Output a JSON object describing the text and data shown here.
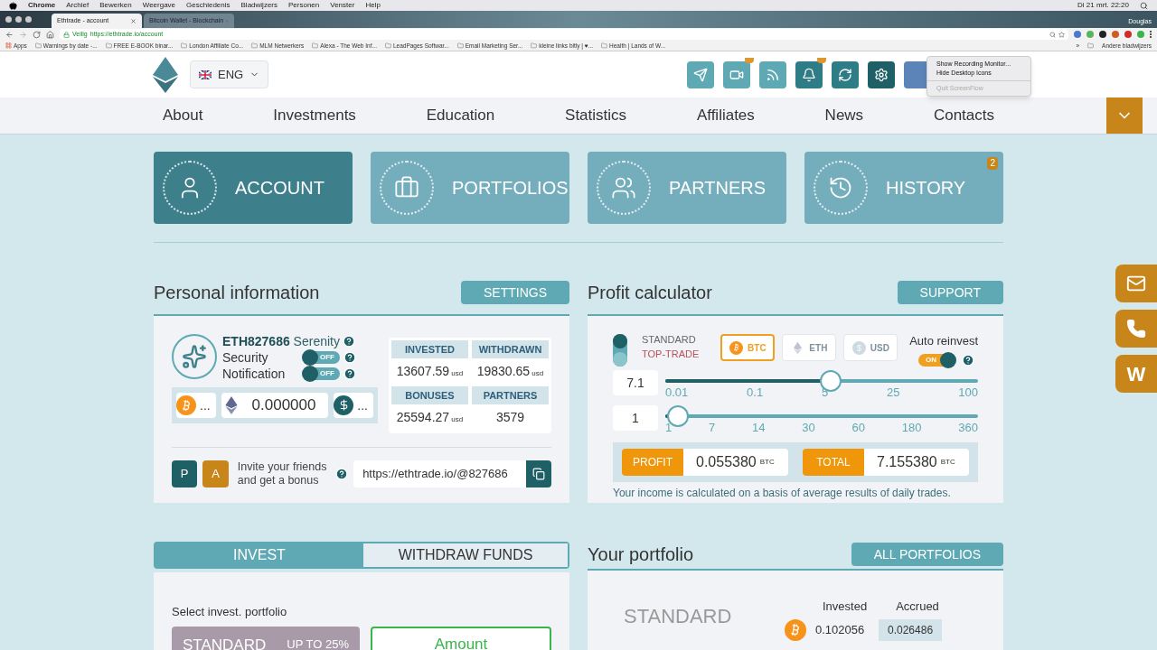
{
  "menubar": {
    "items": [
      "Chrome",
      "Archief",
      "Bewerken",
      "Weergave",
      "Geschiedenis",
      "Bladwijzers",
      "Personen",
      "Venster",
      "Help"
    ],
    "clock": "Di 21 mrt. 22:20"
  },
  "browser": {
    "tabs": [
      {
        "title": "Ethtrade - account",
        "selected": true
      },
      {
        "title": "Bitcoin Wallet - Blockchain",
        "selected": false
      }
    ],
    "user": "Douglas",
    "secure_label": "Veilig",
    "url": "https://ethtrade.io/account",
    "bookmarks": [
      "Apps",
      "Warnings by date -...",
      "FREE E-BOOK binar...",
      "London Affiliate Co...",
      "MLM Netwerkers",
      "Alexa - The Web Inf...",
      "LeadPages Softwar...",
      "Email Marketing Ser...",
      "kleine links bitly | ♥...",
      "Health | Lands of W..."
    ],
    "more": "»",
    "other_bookmarks": "Andere bladwijzers"
  },
  "header": {
    "language": "ENG",
    "toolbar": [
      {
        "kind": "send",
        "badge": false
      },
      {
        "kind": "video",
        "badge": true
      },
      {
        "kind": "rss",
        "badge": false
      },
      {
        "kind": "bell",
        "badge": true
      },
      {
        "kind": "exchange",
        "badge": false
      },
      {
        "kind": "settings",
        "badge": false
      },
      {
        "kind": "blank",
        "badge": false
      }
    ],
    "context_menu": [
      {
        "label": "Show Recording Monitor...",
        "disabled": false
      },
      {
        "label": "Hide Desktop Icons",
        "disabled": false
      },
      {
        "label": "Quit ScreenFlow",
        "disabled": true
      }
    ]
  },
  "nav": [
    "About",
    "Investments",
    "Education",
    "Statistics",
    "Affiliates",
    "News",
    "Contacts"
  ],
  "cards": [
    {
      "kind": "account",
      "label": "ACCOUNT",
      "selected": true
    },
    {
      "kind": "portfolios",
      "label": "PORTFOLIOS",
      "selected": false
    },
    {
      "kind": "partners",
      "label": "PARTNERS",
      "selected": false
    },
    {
      "kind": "history",
      "label": "HISTORY",
      "selected": false,
      "badge": "2"
    }
  ],
  "personal": {
    "title": "Personal information",
    "button": "SETTINGS",
    "user_id": "ETH827686",
    "user_name": "Serenity",
    "toggles": [
      {
        "label": "Security",
        "on": false,
        "text": "OFF"
      },
      {
        "label": "Notification",
        "on": false,
        "text": "OFF"
      }
    ],
    "balances": [
      {
        "kind": "btc",
        "value": "..."
      },
      {
        "kind": "eth",
        "value": "0.000000"
      },
      {
        "kind": "usd",
        "value": "..."
      }
    ],
    "stats": [
      {
        "label": "INVESTED",
        "value": "13607.59",
        "unit": "usd"
      },
      {
        "label": "WITHDRAWN",
        "value": "19830.65",
        "unit": "usd"
      },
      {
        "label": "BONUSES",
        "value": "25594.27",
        "unit": "usd"
      },
      {
        "label": "PARTNERS",
        "value": "3579"
      }
    ],
    "badges": [
      {
        "label": "P",
        "color": "#1f5f66"
      },
      {
        "label": "A",
        "color": "#c8861a"
      }
    ],
    "invite": "Invite your friends and get a bonus",
    "link": "https://ethtrade.io/@827686"
  },
  "calculator": {
    "title": "Profit calculator",
    "button": "SUPPORT",
    "plans": [
      {
        "label": "STANDARD",
        "selected": true,
        "color": "#666666"
      },
      {
        "label": "TOP-TRADE",
        "selected": false,
        "color": "#b5525a"
      }
    ],
    "currencies": [
      {
        "kind": "btc",
        "label": "BTC",
        "selected": true
      },
      {
        "kind": "eth",
        "label": "ETH",
        "selected": false
      },
      {
        "kind": "usd",
        "label": "USD",
        "selected": false
      }
    ],
    "auto_reinvest": {
      "label": "Auto reinvest",
      "on": true,
      "text": "ON"
    },
    "sliders": [
      {
        "value": "7.1",
        "level": 0.53,
        "ticks": [
          "0.01",
          "0.1",
          "5",
          "25",
          "100"
        ]
      },
      {
        "value": "1",
        "level": 0.04,
        "ticks": [
          "1",
          "7",
          "14",
          "30",
          "60",
          "180",
          "360"
        ]
      }
    ],
    "results": [
      {
        "label": "PROFIT",
        "value": "0.055380",
        "unit": "BTC"
      },
      {
        "label": "TOTAL",
        "value": "7.155380",
        "unit": "BTC"
      }
    ],
    "note": "Your income is calculated on a basis of average results of daily trades."
  },
  "invest": {
    "tabs": [
      {
        "label": "INVEST",
        "selected": true
      },
      {
        "label": "WITHDRAW FUNDS",
        "selected": false
      }
    ],
    "select_label": "Select invest. portfolio",
    "option": {
      "name": "STANDARD",
      "rate": "UP TO 25%"
    },
    "amount_placeholder": "Amount"
  },
  "portfolio": {
    "title": "Your portfolio",
    "button": "ALL PORTFOLIOS",
    "plan": "STANDARD",
    "columns": [
      "Invested",
      "Accrued"
    ],
    "values": [
      "0.102056",
      "0.026486"
    ]
  },
  "side_buttons": [
    {
      "kind": "mail"
    },
    {
      "kind": "phone"
    },
    {
      "kind": "letter",
      "label": "W"
    }
  ]
}
